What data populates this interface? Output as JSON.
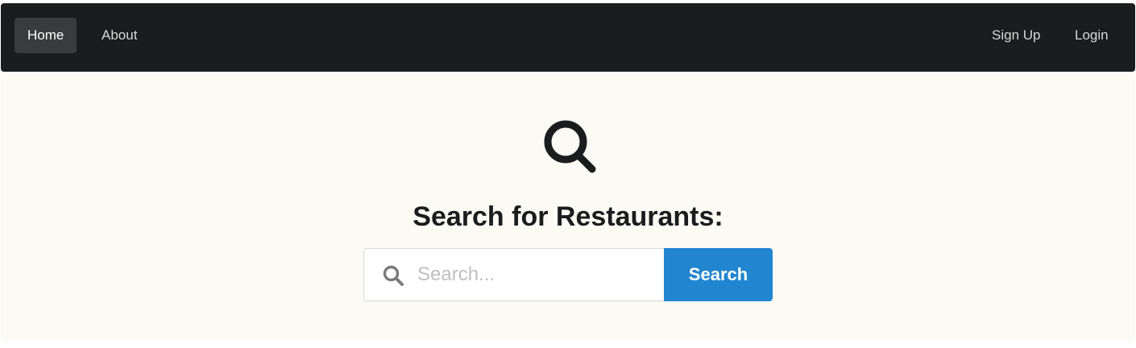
{
  "navbar": {
    "left_items": [
      {
        "label": "Home",
        "active": true
      },
      {
        "label": "About",
        "active": false
      }
    ],
    "right_items": [
      {
        "label": "Sign Up"
      },
      {
        "label": "Login"
      }
    ]
  },
  "hero": {
    "icon": "search-icon",
    "title": "Search for Restaurants:"
  },
  "search": {
    "placeholder": "Search...",
    "value": "",
    "input_icon": "search-icon",
    "button_label": "Search"
  },
  "colors": {
    "navbar_background": "#1b1c1d",
    "page_background": "#fbfaf5",
    "primary_button": "#2185d0",
    "title_text": "#1b1c1d"
  }
}
